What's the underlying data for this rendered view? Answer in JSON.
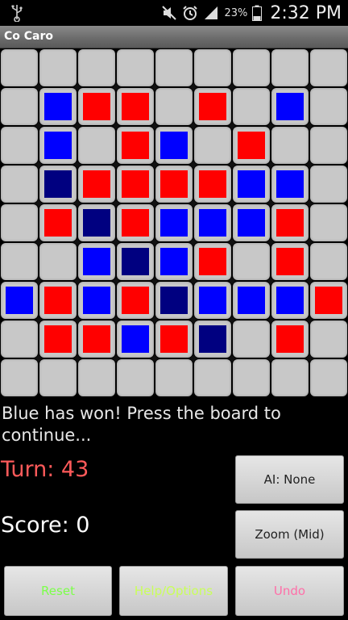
{
  "status_bar": {
    "usb_icon": "usb-icon",
    "mute_icon": "mute-icon",
    "alarm_icon": "alarm-icon",
    "signal_icon": "signal-icon",
    "battery_percent": "23%",
    "battery_icon": "battery-icon",
    "time": "2:32 PM"
  },
  "app": {
    "title": "Co Caro"
  },
  "board": {
    "rows": 9,
    "cols": 9,
    "grid": [
      "_________",
      "_BRR_R_B_",
      "_B_RB_R__",
      "_NRRRRBB_",
      "_RNRBBBR_",
      "__BNBR_R_",
      "BRBRNBBBR",
      "_RRBRN_R_",
      "_________"
    ],
    "colors": {
      "B": "#0000ff",
      "R": "#ff0000",
      "N": "#000080",
      "empty": "#c8c8c8"
    }
  },
  "message": "Blue has won! Press the board to continue...",
  "turn_text": "Turn: 43",
  "score_text": "Score: 0",
  "buttons": {
    "ai": "AI: None",
    "zoom": "Zoom (Mid)",
    "reset": "Reset",
    "help": "Help/Options",
    "undo": "Undo"
  }
}
